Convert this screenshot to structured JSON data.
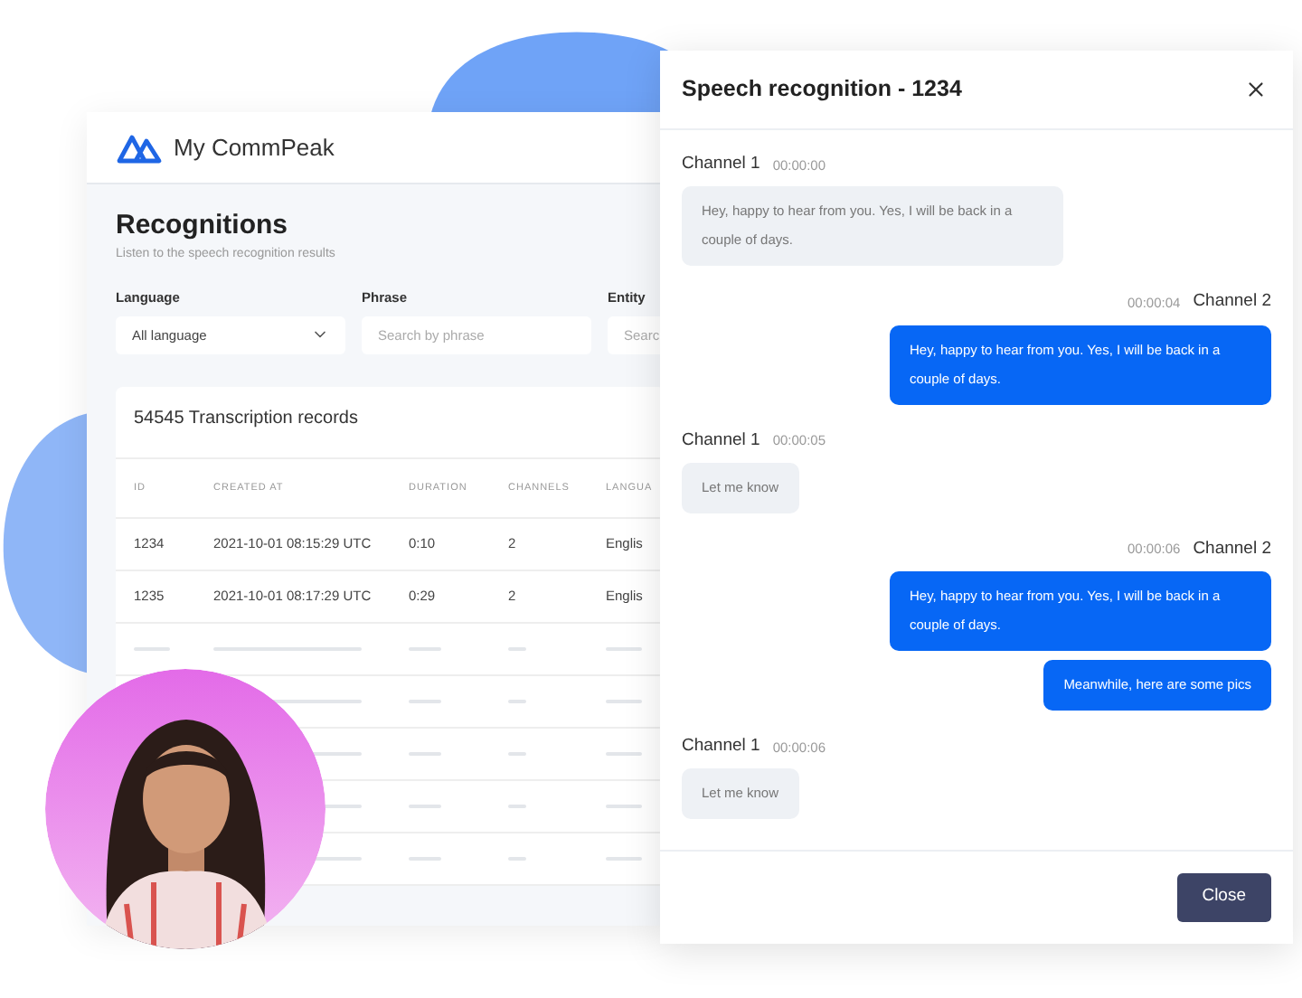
{
  "app": {
    "brand": "My CommPeak"
  },
  "page": {
    "title": "Recognitions",
    "subtitle": "Listen to the speech recognition results"
  },
  "filters": [
    {
      "label": "Language",
      "kind": "select",
      "value": "All language"
    },
    {
      "label": "Phrase",
      "kind": "text",
      "placeholder": "Search by phrase"
    },
    {
      "label": "Entity",
      "kind": "text",
      "placeholder": "Searc"
    }
  ],
  "table": {
    "title": "54545 Transcription records",
    "columns": [
      "ID",
      "CREATED AT",
      "DURATION",
      "CHANNELS",
      "LANGUA"
    ],
    "rows": [
      [
        "1234",
        "2021-10-01 08:15:29 UTC",
        "0:10",
        "2",
        "Englis"
      ],
      [
        "1235",
        "2021-10-01 08:17:29 UTC",
        "0:29",
        "2",
        "Englis"
      ]
    ]
  },
  "dialog": {
    "title": "Speech recognition - 1234",
    "messages": [
      {
        "kind": "received",
        "channel": "Channel 1",
        "time": "00:00:00",
        "bubbles": [
          "Hey, happy to hear from you. Yes, I will be back in a couple of days."
        ]
      },
      {
        "kind": "sent",
        "channel": "Channel 2",
        "time": "00:00:04",
        "bubbles": [
          "Hey, happy to hear from you. Yes, I will be back in a couple of days."
        ]
      },
      {
        "kind": "received",
        "channel": "Channel 1",
        "time": "00:00:05",
        "bubbles": [
          "Let me know"
        ]
      },
      {
        "kind": "sent",
        "channel": "Channel 2",
        "time": "00:00:06",
        "bubbles": [
          "Hey, happy to hear from you. Yes, I will be back in a couple of days.",
          "Meanwhile, here are some pics"
        ]
      },
      {
        "kind": "received",
        "channel": "Channel 1",
        "time": "00:00:06",
        "bubbles": [
          "Let me know"
        ]
      }
    ],
    "button": "Close"
  }
}
